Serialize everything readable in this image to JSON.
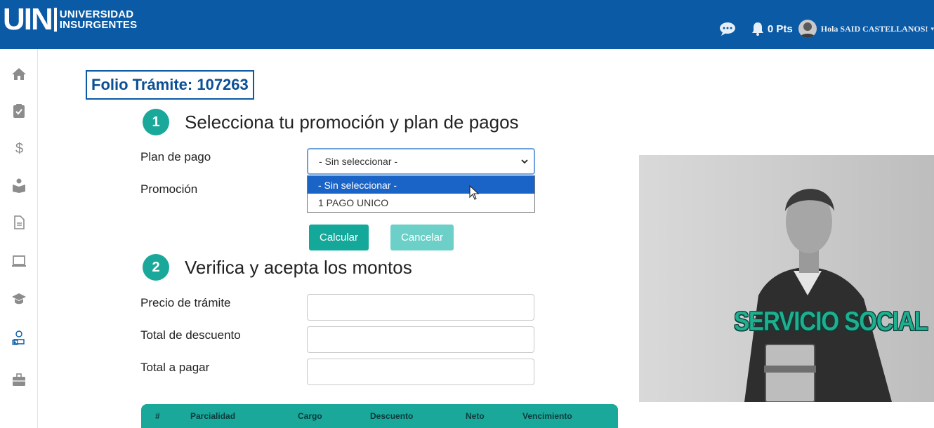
{
  "header": {
    "logo_big": "UIN",
    "logo_line1": "UNIVERSIDAD",
    "logo_line2": "INSURGENTES",
    "points": "0 Pts",
    "greeting": "Hola SAID CASTELLANOS!",
    "brand_color": "#0b5aa6"
  },
  "sidebar": {
    "items": [
      {
        "icon": "home-icon"
      },
      {
        "icon": "clipboard-check-icon"
      },
      {
        "icon": "dollar-icon"
      },
      {
        "icon": "reader-icon"
      },
      {
        "icon": "document-icon"
      },
      {
        "icon": "laptop-icon"
      },
      {
        "icon": "graduation-cap-icon"
      },
      {
        "icon": "service-person-icon"
      },
      {
        "icon": "briefcase-icon"
      }
    ]
  },
  "folio": "Folio Trámite: 107263",
  "step1": {
    "number": "1",
    "title": "Selecciona tu promoción y plan de pagos",
    "plan_label": "Plan de pago",
    "promo_label": "Promoción",
    "plan_selected": "- Sin seleccionar -",
    "plan_options": [
      "- Sin seleccionar -",
      "1 PAGO UNICO"
    ],
    "calc_button": "Calcular",
    "cancel_button": "Cancelar"
  },
  "step2": {
    "number": "2",
    "title": "Verifica y acepta los montos",
    "price_label": "Precio de trámite",
    "discount_label": "Total de descuento",
    "total_label": "Total a pagar"
  },
  "table": {
    "headers": [
      "#",
      "Parcialidad",
      "Cargo",
      "Descuento",
      "Neto",
      "Vencimiento"
    ]
  },
  "promo": {
    "text": "SERVICIO SOCIAL",
    "accent": "#1aa89b"
  }
}
